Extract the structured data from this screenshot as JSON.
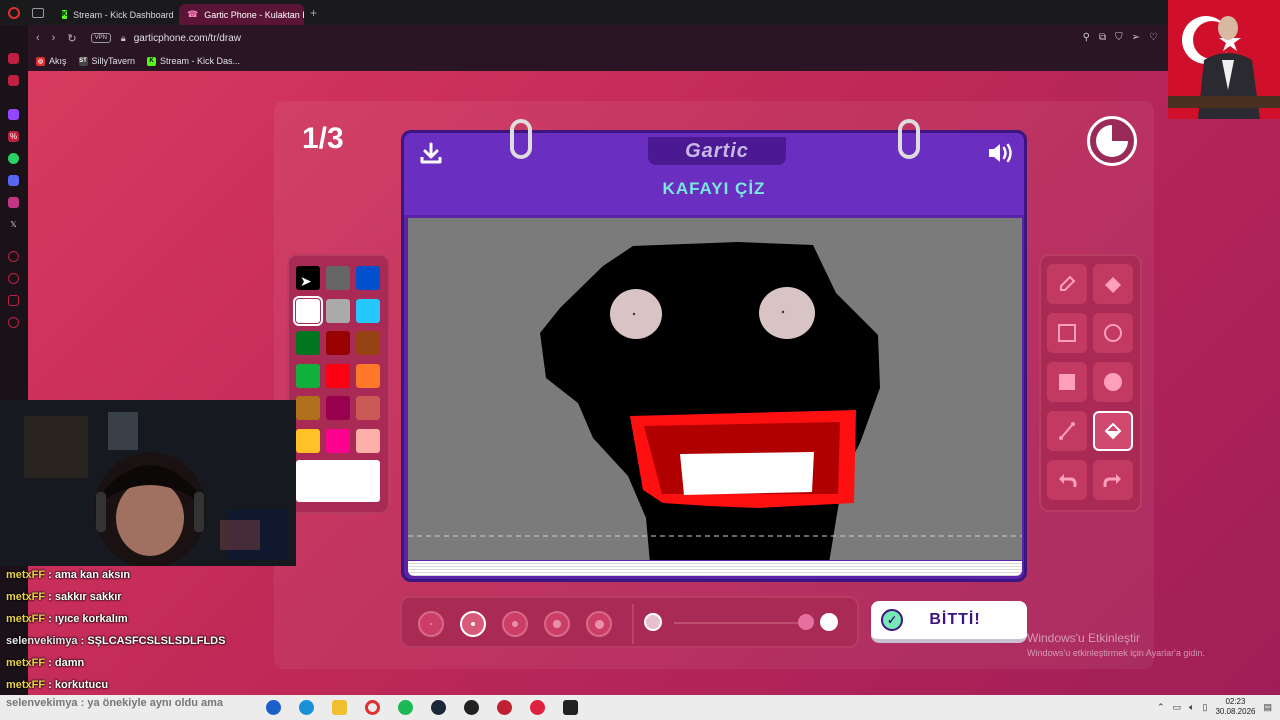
{
  "browser": {
    "tabs": [
      {
        "label": "Stream - Kick Dashboard",
        "active": false
      },
      {
        "label": "Gartic Phone - Kulaktan Ku",
        "active": true
      }
    ],
    "url": "garticphone.com/tr/draw",
    "vpn_label": "VPN",
    "bookmarks": [
      {
        "label": "Akış",
        "icon": "opera-news-icon",
        "color": "#e0302f"
      },
      {
        "label": "SillyTavern",
        "icon": "sillytavern-icon",
        "color": "#444444",
        "badge": "ST"
      },
      {
        "label": "Stream - Kick Das...",
        "icon": "kick-icon",
        "color": "#53fc18",
        "badge": "K"
      }
    ]
  },
  "game": {
    "round": "1/3",
    "logo": "Gartic",
    "prompt": "KAFAYI ÇİZ",
    "timer_elapsed_fraction": 0.25,
    "done_label": "BİTTİ!",
    "selected_color": "#ffffff",
    "selected_tool": "fill",
    "selected_size_index": 1,
    "palette": [
      "#000000",
      "#666666",
      "#0050cd",
      "#ffffff",
      "#aaaaaa",
      "#26c9ff",
      "#017420",
      "#990000",
      "#964112",
      "#11b03c",
      "#ff0013",
      "#ff7829",
      "#b0701c",
      "#99004e",
      "#cb5a57",
      "#ffc126",
      "#ff008f",
      "#feafa8"
    ],
    "tools": [
      {
        "name": "pencil",
        "icon": "pencil-icon"
      },
      {
        "name": "eraser",
        "icon": "eraser-icon"
      },
      {
        "name": "rectangle",
        "icon": "rectangle-outline-icon"
      },
      {
        "name": "ellipse",
        "icon": "ellipse-outline-icon"
      },
      {
        "name": "filled-rectangle",
        "icon": "rectangle-filled-icon"
      },
      {
        "name": "filled-ellipse",
        "icon": "ellipse-filled-icon"
      },
      {
        "name": "line",
        "icon": "line-icon"
      },
      {
        "name": "fill",
        "icon": "paint-bucket-icon"
      },
      {
        "name": "undo",
        "icon": "undo-icon"
      },
      {
        "name": "redo",
        "icon": "redo-icon"
      }
    ],
    "brush_sizes": [
      1,
      2,
      3,
      4,
      5
    ],
    "opacity_level": 1.0
  },
  "windows_activation": {
    "title": "Windows'u Etkinleştir",
    "subtitle": "Windows'u etkinleştirmek için Ayarlar'a gidin."
  },
  "chat": [
    {
      "user": "metxFF",
      "message": "ama kan aksın"
    },
    {
      "user": "metxFF",
      "message": "sakkır sakkır"
    },
    {
      "user": "metxFF",
      "message": "ıyıce korkalım"
    },
    {
      "user": "selenvekimya",
      "message": "SŞLCASFCSLSLSDLFLDS"
    },
    {
      "user": "metxFF",
      "message": "damn"
    },
    {
      "user": "metxFF",
      "message": "korkutucu"
    }
  ],
  "chat_ghost": "selenvekimya : ya önekiyle aynı oldu ama",
  "taskbar": {
    "time": "02:23",
    "date": "30.08.2026"
  }
}
